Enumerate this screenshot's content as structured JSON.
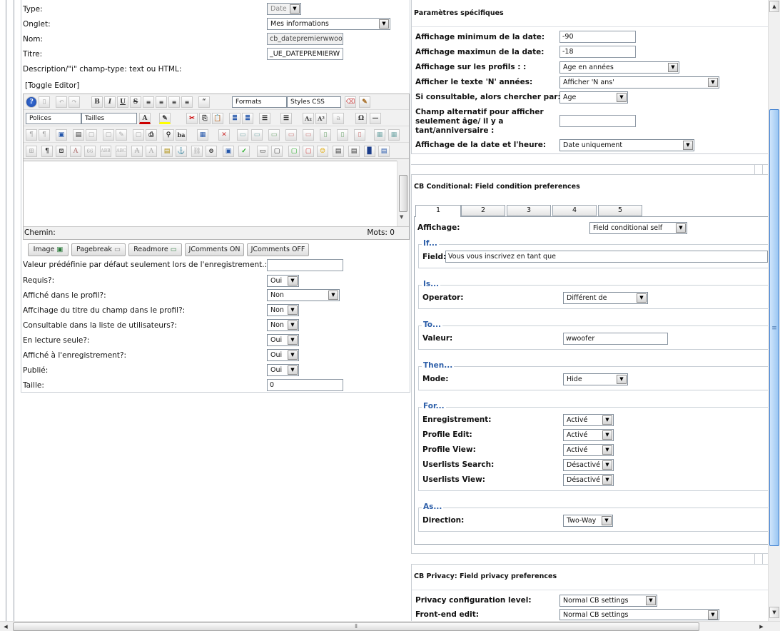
{
  "left": {
    "type": {
      "label": "Type:",
      "value": "Date"
    },
    "onglet": {
      "label": "Onglet:",
      "value": "Mes informations"
    },
    "nom": {
      "label": "Nom:",
      "value": "cb_datepremierwwoofi"
    },
    "titre": {
      "label": "Titre:",
      "value": "_UE_DATEPREMIERW"
    },
    "description_label": "Description/\"i\" champ-type: text ou HTML:",
    "toggle_editor": "[Toggle Editor]",
    "editor": {
      "formats": "Formats",
      "styles": "Styles CSS",
      "polices": "Polices",
      "tailles": "Tailles",
      "path_label": "Chemin:",
      "words_label": "Mots: 0"
    },
    "buttons": {
      "image": "Image",
      "pagebreak": "Pagebreak",
      "readmore": "Readmore",
      "jcomments_on": "JComments ON",
      "jcomments_off": "JComments OFF"
    },
    "default_value": {
      "label": "Valeur prédéfinie par défaut seulement lors de l'enregistrement.:",
      "value": ""
    },
    "requis": {
      "label": "Requis?:",
      "value": "Oui"
    },
    "profil": {
      "label": "Affiché dans le profil?:",
      "value": "Non"
    },
    "titre_profil": {
      "label": "Affcihage du titre du champ dans le profil?:",
      "value": "Non"
    },
    "consultable": {
      "label": "Consultable dans la liste de utilisateurs?:",
      "value": "Non"
    },
    "lecture": {
      "label": "En lecture seule?:",
      "value": "Oui"
    },
    "enregistrement": {
      "label": "Affiché à l'enregistrement?:",
      "value": "Oui"
    },
    "publie": {
      "label": "Publié:",
      "value": "Oui"
    },
    "taille": {
      "label": "Taille:",
      "value": "0"
    }
  },
  "params": {
    "header": "Paramètres spécifiques",
    "min_date": {
      "label": "Affichage minimum de la date:",
      "value": "-90"
    },
    "max_date": {
      "label": "Affichage maximun de la date:",
      "value": "-18"
    },
    "profils": {
      "label": "Affichage sur les profils : :",
      "value": "Age en années"
    },
    "texte_n": {
      "label": "Afficher le texte 'N' années:",
      "value": "Afficher 'N ans'"
    },
    "consultable": {
      "label": "Si consultable, alors chercher par:",
      "value": "Age"
    },
    "alt_line1": "Champ alternatif pour afficher",
    "alt_line2": "seulement âge/ il y a",
    "alt_line3": "tant/anniversaire :",
    "alt_value": "",
    "date_heure": {
      "label": "Affichage de la date et l'heure:",
      "value": "Date uniquement"
    }
  },
  "conditional": {
    "header": "CB Conditional: Field condition preferences",
    "tabs": [
      "1",
      "2",
      "3",
      "4",
      "5"
    ],
    "affichage": {
      "label": "Affichage:",
      "value": "Field conditional self"
    },
    "if_legend": "If...",
    "field": {
      "label": "Field:",
      "value": "Vous vous inscrivez en tant que"
    },
    "is_legend": "Is...",
    "operator": {
      "label": "Operator:",
      "value": "Différent de"
    },
    "to_legend": "To...",
    "valeur": {
      "label": "Valeur:",
      "value": "wwoofer"
    },
    "then_legend": "Then...",
    "mode": {
      "label": "Mode:",
      "value": "Hide"
    },
    "for_legend": "For...",
    "enregistrement": {
      "label": "Enregistrement:",
      "value": "Activé"
    },
    "profile_edit": {
      "label": "Profile Edit:",
      "value": "Activé"
    },
    "profile_view": {
      "label": "Profile View:",
      "value": "Activé"
    },
    "userlists_search": {
      "label": "Userlists Search:",
      "value": "Désactivé"
    },
    "userlists_view": {
      "label": "Userlists View:",
      "value": "Désactivé"
    },
    "as_legend": "As...",
    "direction": {
      "label": "Direction:",
      "value": "Two-Way"
    }
  },
  "privacy": {
    "header": "CB Privacy: Field privacy preferences",
    "level": {
      "label": "Privacy configuration level:",
      "value": "Normal CB settings"
    },
    "frontend": {
      "label": "Front-end edit:",
      "value": "Normal CB settings"
    }
  },
  "icons": [
    "help-icon",
    "bold-icon",
    "italic-icon",
    "underline-icon",
    "strike-icon",
    "align-icons",
    "cut-icon",
    "copy-icon",
    "paste-icon",
    "smiley-icon",
    "chevron-down-icon"
  ]
}
